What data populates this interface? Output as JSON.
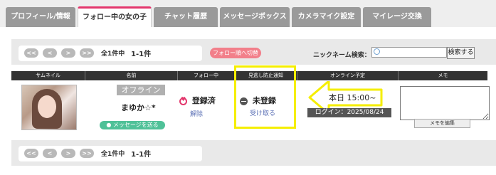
{
  "tabs": [
    {
      "label": "プロフィール/情報",
      "active": false
    },
    {
      "label": "フォロー中の女の子",
      "active": true
    },
    {
      "label": "チャット履歴",
      "active": false
    },
    {
      "label": "メッセージボックス",
      "active": false
    },
    {
      "label": "カメラマイク設定",
      "active": false
    },
    {
      "label": "マイレージ交換",
      "active": false
    }
  ],
  "pager": {
    "first": "<<",
    "prev": "<",
    "next": ">",
    "last": ">>",
    "total": "全1件中",
    "range": "1-1件"
  },
  "follow_order_button": "フォロー順へ切替",
  "nickname_search": {
    "label": "ニックネーム検索：",
    "value": "",
    "button": "検索する"
  },
  "table": {
    "headers": [
      "サムネイル",
      "名前",
      "フォロー中",
      "見逃し防止通知",
      "オンライン予定",
      "メモ"
    ],
    "rows": [
      {
        "status": "オフライン",
        "name": "まゆか☆*",
        "message_button": "メッセージを送る",
        "follow_state": "登録済",
        "follow_action": "解除",
        "notify_state": "未登録",
        "notify_action": "受け取る",
        "online_plan": "本日 15:00~",
        "login": "ログイン：2025/08/24",
        "memo_value": "",
        "memo_button": "メモを編集"
      }
    ]
  },
  "colors": {
    "active_tab_accent": "#e3366c",
    "highlight": "#f5ee00",
    "message_button": "#4fc198"
  }
}
